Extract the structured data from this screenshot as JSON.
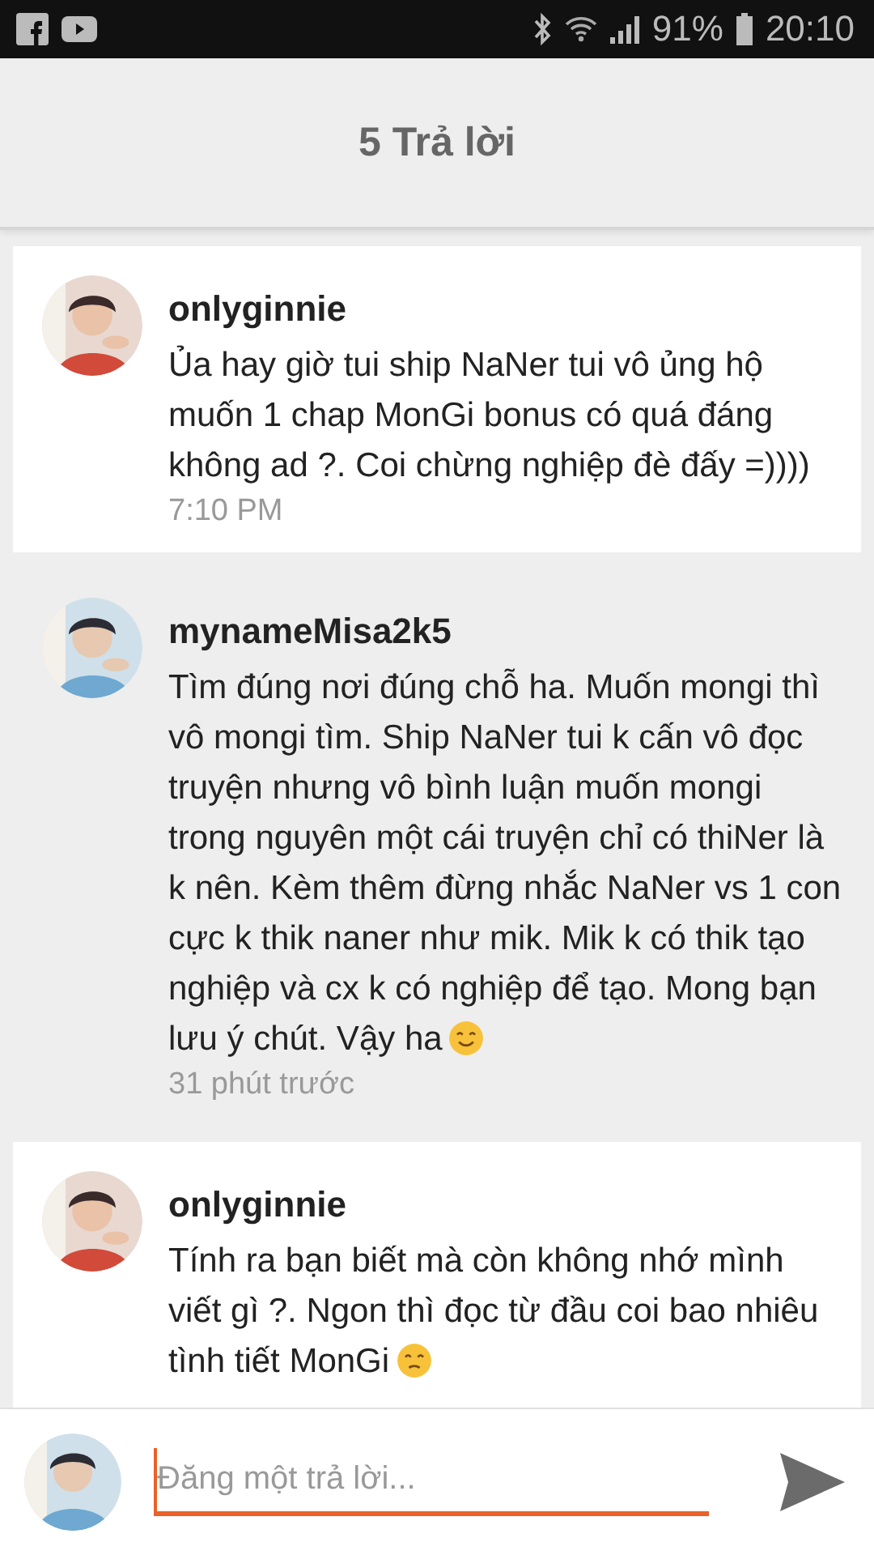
{
  "status_bar": {
    "battery": "91%",
    "time": "20:10"
  },
  "header": {
    "title": "5 Trả lời"
  },
  "comments": [
    {
      "author": "onlyginnie",
      "highlighted": true,
      "kind": "plain",
      "text": "Ủa hay giờ tui ship NaNer tui vô ủng hộ muốn 1 chap MonGi bonus có quá đáng không ad ?. Coi chừng nghiệp đè đấy =))))",
      "time": "7:10 PM"
    },
    {
      "author": "mynameMisa2k5",
      "highlighted": false,
      "text": "Tìm đúng nơi đúng chỗ ha. Muốn mongi thì vô mongi tìm. Ship NaNer tui k cấn vô đọc truyện nhưng vô bình luận muốn mongi trong nguyên một cái truyện chỉ có thiNer là k nên. Kèm thêm đừng nhắc NaNer vs 1 con cực k thik naner như mik. Mik k có thik tạo nghiệp và cx k có nghiệp để tạo. Mong bạn lưu ý chút. Vậy ha",
      "kind": "smile",
      "time": "31 phút trước"
    },
    {
      "author": "onlyginnie",
      "highlighted": true,
      "text": "Tính ra bạn biết mà còn không nhớ mình viết gì ?. Ngon thì đọc từ đầu coi bao nhiêu tình tiết MonGi",
      "kind": "frown"
    }
  ],
  "composer": {
    "placeholder": "Đăng một trả lời..."
  }
}
